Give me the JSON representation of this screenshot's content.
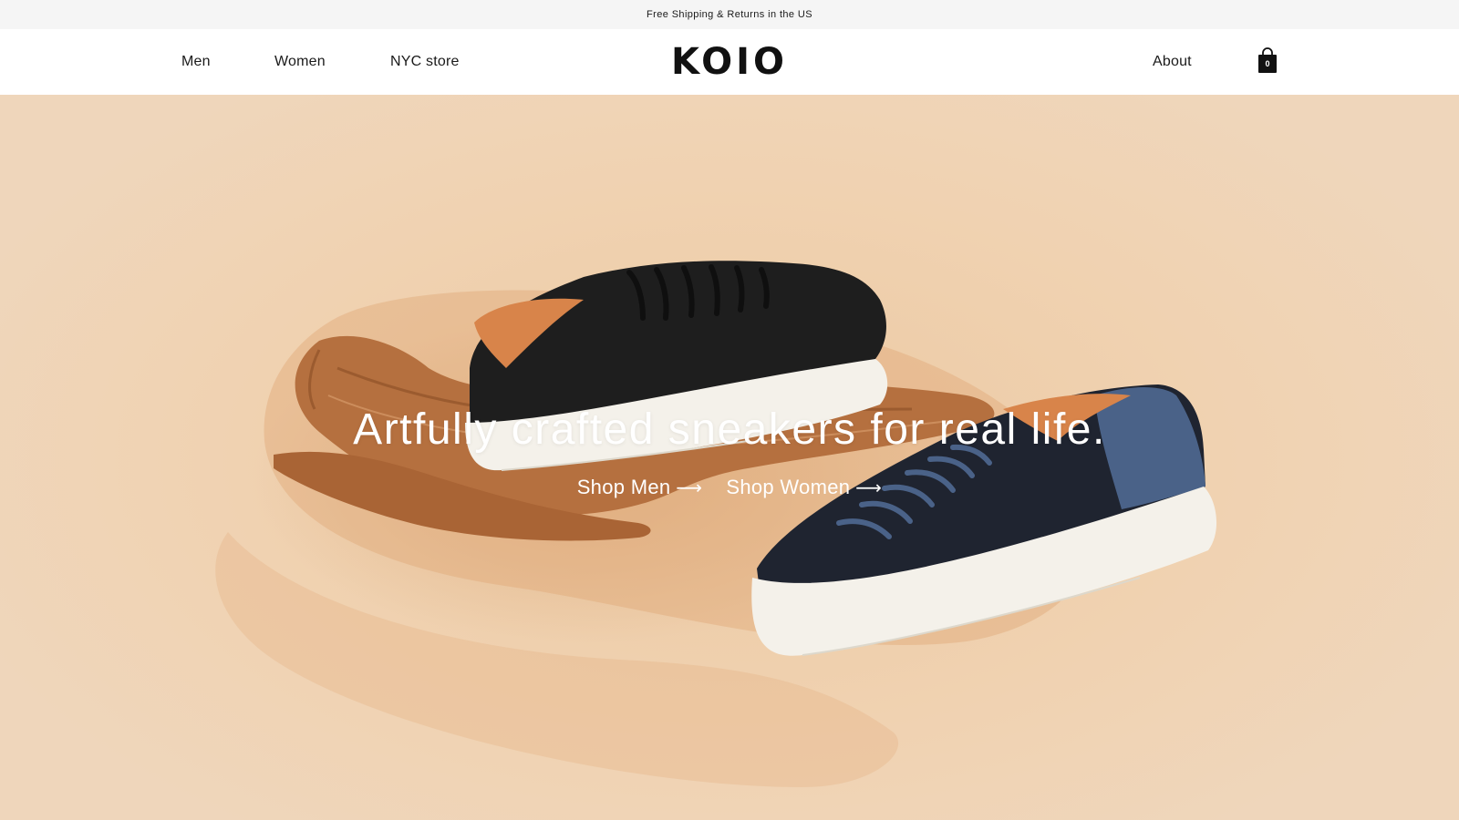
{
  "announcement": {
    "text": "Free Shipping & Returns in the US"
  },
  "header": {
    "nav_left": [
      {
        "label": "Men"
      },
      {
        "label": "Women"
      },
      {
        "label": "NYC store"
      }
    ],
    "logo": "KOIO",
    "nav_right": {
      "about": "About"
    },
    "cart": {
      "icon": "shopping-bag-icon",
      "count": "0"
    }
  },
  "hero": {
    "headline": "Artfully crafted sneakers for real life.",
    "ctas": [
      {
        "label": "Shop Men",
        "icon": "arrow-right-icon",
        "arrow": "⟶"
      },
      {
        "label": "Shop Women",
        "icon": "arrow-right-icon",
        "arrow": "⟶"
      }
    ],
    "colors": {
      "sand": "#efd2b3",
      "driftwood": "#b5703f",
      "black_sneaker": "#1e1e1e",
      "navy_sneaker": "#1f2430",
      "suede_blue": "#4a6288",
      "sole": "#f4f1ea"
    }
  },
  "colors": {
    "announcement_bg": "#f5f5f5",
    "text_dark": "#1a1a1a",
    "header_bg": "#ffffff"
  }
}
